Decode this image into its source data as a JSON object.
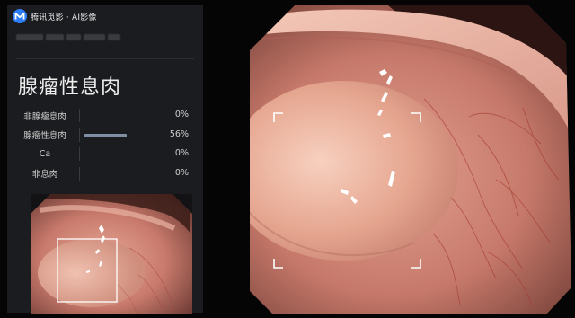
{
  "app": {
    "brand_name": "腾讯觅影 · AI影像",
    "brand_icon": "brand-logo-icon",
    "accent_color": "#2f7df6"
  },
  "diagnosis": {
    "title": "腺瘤性息肉",
    "probabilities": [
      {
        "label": "非腺瘤息肉",
        "value": "0%",
        "fraction": 0.0
      },
      {
        "label": "腺瘤性息肉",
        "value": "56%",
        "fraction": 0.56
      },
      {
        "label": "Ca",
        "value": "0%",
        "fraction": 0.0
      },
      {
        "label": "非息肉",
        "value": "0%",
        "fraction": 0.0
      }
    ],
    "bar_color": "#7f8fa3"
  },
  "images": {
    "main_view": "endoscopy-polyp-image",
    "thumbnail": "endoscopy-thumbnail-image",
    "detection_box": "focus-bracket-box"
  }
}
